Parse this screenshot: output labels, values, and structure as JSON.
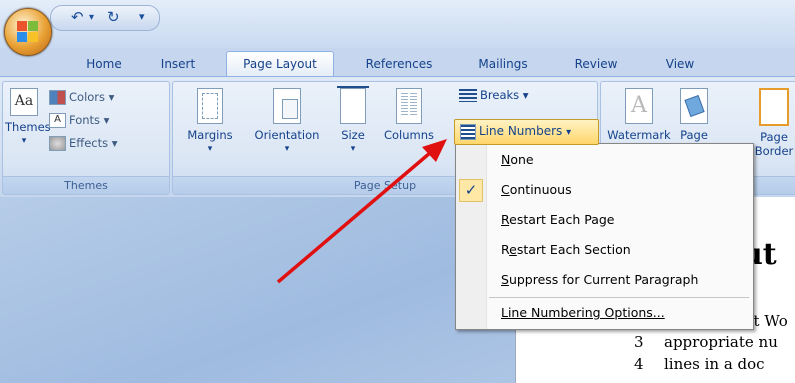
{
  "ribbon_tabs": [
    "Home",
    "Insert",
    "Page Layout",
    "References",
    "Mailings",
    "Review",
    "View"
  ],
  "active_tab": "Page Layout",
  "themes_group": {
    "themes_label": "Themes",
    "colors_label": "Colors",
    "fonts_label": "Fonts",
    "effects_label": "Effects",
    "group_label": "Themes"
  },
  "page_setup_group": {
    "margins_label": "Margins",
    "orientation_label": "Orientation",
    "size_label": "Size",
    "columns_label": "Columns",
    "breaks_label": "Breaks",
    "line_numbers_label": "Line Numbers",
    "group_label": "Page Setup"
  },
  "page_background_group": {
    "watermark_label": "Watermark",
    "page_color_label": "Page",
    "page_borders_label_1": "Page",
    "page_borders_label_2": "Border",
    "group_label": "nd"
  },
  "line_numbers_menu": {
    "items": [
      {
        "label": "None",
        "checked": false,
        "accel": "N"
      },
      {
        "label": "Continuous",
        "checked": true,
        "accel": "C"
      },
      {
        "label": "Restart Each Page",
        "checked": false,
        "accel": "R"
      },
      {
        "label": "Restart Each Section",
        "checked": false,
        "accel": "e"
      },
      {
        "label": "Suppress for Current Paragraph",
        "checked": false,
        "accel": "S"
      }
    ],
    "options_label": "Line Numbering Options...",
    "check_glyph": "✓"
  },
  "document": {
    "heading_fragment": "ut",
    "lines": [
      {
        "num": "",
        "text": "ft Wo"
      },
      {
        "num": "3",
        "text": "appropriate nu"
      },
      {
        "num": "4",
        "text": "lines in a doc"
      }
    ]
  },
  "annotation_arrow_color": "#e01010"
}
